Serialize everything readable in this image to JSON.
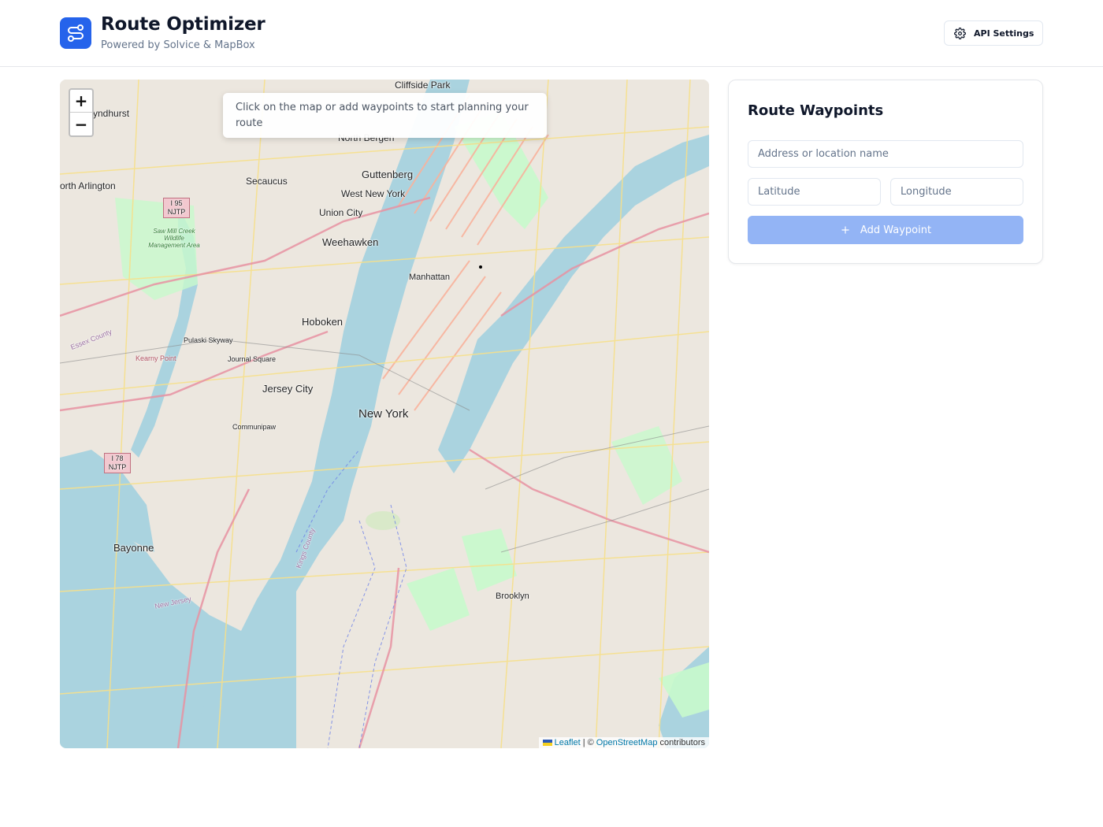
{
  "header": {
    "title": "Route Optimizer",
    "subtitle": "Powered by Solvice & MapBox",
    "api_settings_label": "API Settings"
  },
  "map": {
    "zoom_in": "+",
    "zoom_out": "−",
    "hint": "Click on the map or add waypoints to start planning your route",
    "attribution": {
      "leaflet": "Leaflet",
      "separator": "| ©",
      "osm": "OpenStreetMap",
      "suffix": "contributors"
    },
    "labels": {
      "new_york": "New York",
      "manhattan": "Manhattan",
      "brooklyn": "Brooklyn",
      "jersey_city": "Jersey City",
      "hoboken": "Hoboken",
      "weehawken": "Weehawken",
      "union_city": "Union City",
      "west_new_york": "West New York",
      "guttenberg": "Guttenberg",
      "north_bergen": "North Bergen",
      "secaucus": "Secaucus",
      "cliffside_park": "Cliffside Park",
      "lyndhurst": "yndhurst",
      "north_arlington": "orth Arlington",
      "bayonne": "Bayonne",
      "kearny_point": "Kearny Point",
      "pulaski_skyway": "Pulaski Skyway",
      "journal_square": "Journal Square",
      "communipaw": "Communipaw",
      "kings_county": "Kings County",
      "new_jersey": "New Jersey",
      "essex_county": "Essex County",
      "i95_njtp": "I 95 NJTP",
      "i78_njtp": "I 78 NJTP",
      "wildlife_area": "Saw Mill Creek Wildlife Management Area"
    }
  },
  "panel": {
    "title": "Route Waypoints",
    "address_placeholder": "Address or location name",
    "latitude_placeholder": "Latitude",
    "longitude_placeholder": "Longitude",
    "add_button_label": "Add Waypoint"
  },
  "colors": {
    "primary": "#2563eb",
    "button_disabled": "#93b4f5",
    "water": "#aad3df",
    "park": "#c8facc"
  }
}
